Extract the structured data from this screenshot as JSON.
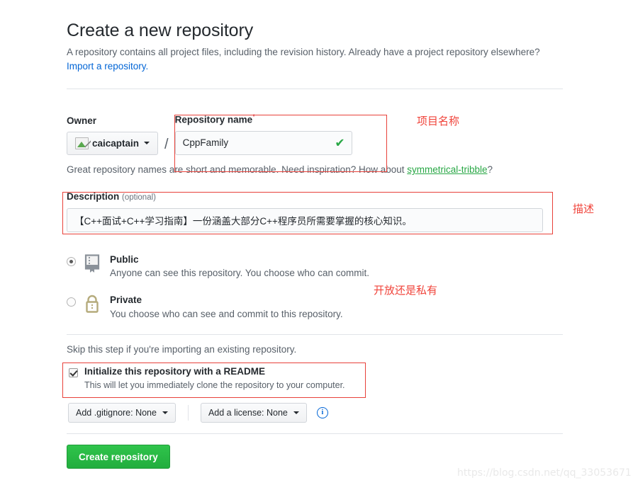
{
  "header": {
    "title": "Create a new repository",
    "subtitle": "A repository contains all project files, including the revision history. Already have a project repository elsewhere?",
    "import_link": "Import a repository."
  },
  "owner": {
    "label": "Owner",
    "name": "caicaptain",
    "separator": "/",
    "avatar_icon": "broken-image-icon",
    "caret_icon": "chevron-down-icon"
  },
  "repository_name": {
    "label": "Repository name",
    "required_marker": "*",
    "value": "CppFamily",
    "valid_icon": "check-icon"
  },
  "hint": {
    "prefix": "Great repository names are short and memorable. Need inspiration? How about ",
    "suggestion": "symmetrical-tribble",
    "suffix": "?"
  },
  "description": {
    "label": "Description",
    "optional": "(optional)",
    "value": "【C++面试+C++学习指南】一份涵盖大部分C++程序员所需要掌握的核心知识。"
  },
  "visibility": {
    "options": [
      {
        "id": "public",
        "title": "Public",
        "description": "Anyone can see this repository. You choose who can commit.",
        "selected": true,
        "icon": "book-icon"
      },
      {
        "id": "private",
        "title": "Private",
        "description": "You choose who can see and commit to this repository.",
        "selected": false,
        "icon": "lock-icon"
      }
    ]
  },
  "init": {
    "skip_note": "Skip this step if you're importing an existing repository.",
    "readme_label": "Initialize this repository with a README",
    "readme_desc": "This will let you immediately clone the repository to your computer.",
    "readme_checked": true,
    "gitignore_button": "Add .gitignore: None",
    "license_button": "Add a license: None",
    "info_icon": "info-icon",
    "info_glyph": "i"
  },
  "submit": {
    "label": "Create repository"
  },
  "annotations": [
    {
      "id": "name",
      "text": "项目名称"
    },
    {
      "id": "description",
      "text": "描述"
    },
    {
      "id": "visibility",
      "text": "开放还是私有"
    }
  ],
  "watermark": "https://blog.csdn.net/qq_33053671",
  "colors": {
    "accent_green": "#28a745",
    "link_blue": "#0366d6",
    "annotation_red": "#f0433a",
    "lock_tan": "#b5ab7c"
  }
}
